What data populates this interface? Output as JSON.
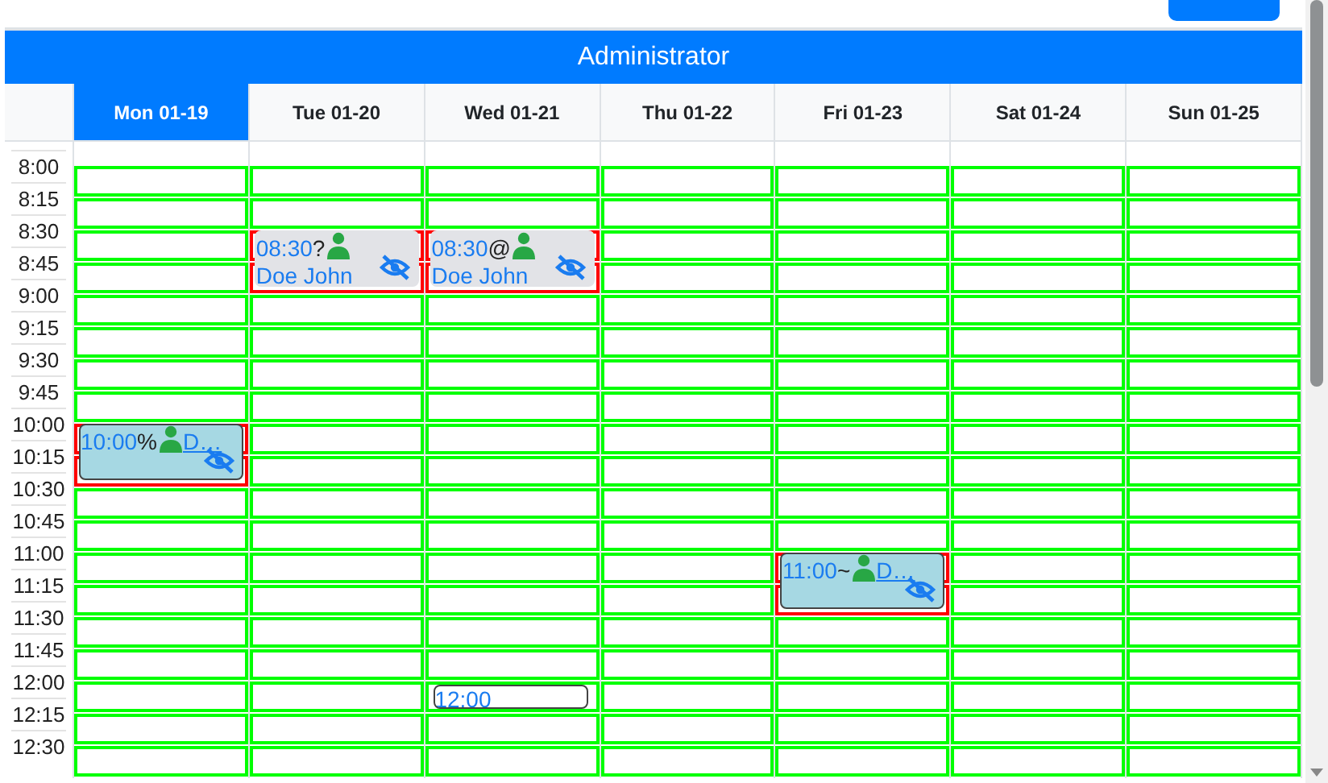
{
  "title": "Administrator",
  "days": [
    {
      "label": "Mon 01-19",
      "selected": true
    },
    {
      "label": "Tue 01-20",
      "selected": false
    },
    {
      "label": "Wed 01-21",
      "selected": false
    },
    {
      "label": "Thu 01-22",
      "selected": false
    },
    {
      "label": "Fri 01-23",
      "selected": false
    },
    {
      "label": "Sat 01-24",
      "selected": false
    },
    {
      "label": "Sun 01-25",
      "selected": false
    }
  ],
  "rows": [
    {
      "time": "8:00",
      "cells": [
        {
          "highlighted": false
        },
        {
          "highlighted": false
        },
        {
          "highlighted": false
        },
        {
          "highlighted": false
        },
        {
          "highlighted": false
        },
        {
          "highlighted": false
        },
        {
          "highlighted": false
        }
      ]
    },
    {
      "time": "8:15",
      "cells": [
        {
          "highlighted": false
        },
        {
          "highlighted": false
        },
        {
          "highlighted": false
        },
        {
          "highlighted": false
        },
        {
          "highlighted": false
        },
        {
          "highlighted": false
        },
        {
          "highlighted": false
        }
      ]
    },
    {
      "time": "8:30",
      "cells": [
        {
          "highlighted": false
        },
        {
          "highlighted": true,
          "event": {
            "kind": "booking",
            "tall": true,
            "color": "#e2e3e7",
            "time": "08:30",
            "symbol": "?",
            "name": "Doe John"
          }
        },
        {
          "highlighted": true,
          "event": {
            "kind": "booking",
            "tall": true,
            "color": "#e2e3e7",
            "time": "08:30",
            "symbol": "@",
            "name": "Doe John"
          }
        },
        {
          "highlighted": false
        },
        {
          "highlighted": false
        },
        {
          "highlighted": false
        },
        {
          "highlighted": false
        }
      ]
    },
    {
      "time": "8:45",
      "cells": [
        {
          "highlighted": false
        },
        {
          "highlighted": true
        },
        {
          "highlighted": true
        },
        {
          "highlighted": false
        },
        {
          "highlighted": false
        },
        {
          "highlighted": false
        },
        {
          "highlighted": false
        }
      ]
    },
    {
      "time": "9:00",
      "cells": [
        {
          "highlighted": false
        },
        {
          "highlighted": false
        },
        {
          "highlighted": false
        },
        {
          "highlighted": false
        },
        {
          "highlighted": false
        },
        {
          "highlighted": false
        },
        {
          "highlighted": false
        }
      ]
    },
    {
      "time": "9:15",
      "cells": [
        {
          "highlighted": false
        },
        {
          "highlighted": false
        },
        {
          "highlighted": false
        },
        {
          "highlighted": false
        },
        {
          "highlighted": false
        },
        {
          "highlighted": false
        },
        {
          "highlighted": false
        }
      ]
    },
    {
      "time": "9:30",
      "cells": [
        {
          "highlighted": false
        },
        {
          "highlighted": false
        },
        {
          "highlighted": false
        },
        {
          "highlighted": false
        },
        {
          "highlighted": false
        },
        {
          "highlighted": false
        },
        {
          "highlighted": false
        }
      ]
    },
    {
      "time": "9:45",
      "cells": [
        {
          "highlighted": false
        },
        {
          "highlighted": false
        },
        {
          "highlighted": false
        },
        {
          "highlighted": false
        },
        {
          "highlighted": false
        },
        {
          "highlighted": false
        },
        {
          "highlighted": false
        }
      ]
    },
    {
      "time": "10:00",
      "cells": [
        {
          "highlighted": true,
          "event": {
            "kind": "booking",
            "tall": true,
            "color": "#a6d8e3",
            "time": "10:00",
            "symbol": "%",
            "name": "D…"
          }
        },
        {
          "highlighted": false
        },
        {
          "highlighted": false
        },
        {
          "highlighted": false
        },
        {
          "highlighted": false
        },
        {
          "highlighted": false
        },
        {
          "highlighted": false
        }
      ]
    },
    {
      "time": "10:15",
      "cells": [
        {
          "highlighted": true
        },
        {
          "highlighted": false
        },
        {
          "highlighted": false
        },
        {
          "highlighted": false
        },
        {
          "highlighted": false
        },
        {
          "highlighted": false
        },
        {
          "highlighted": false
        }
      ]
    },
    {
      "time": "10:30",
      "cells": [
        {
          "highlighted": false
        },
        {
          "highlighted": false
        },
        {
          "highlighted": false
        },
        {
          "highlighted": false
        },
        {
          "highlighted": false
        },
        {
          "highlighted": false
        },
        {
          "highlighted": false
        }
      ]
    },
    {
      "time": "10:45",
      "cells": [
        {
          "highlighted": false
        },
        {
          "highlighted": false
        },
        {
          "highlighted": false
        },
        {
          "highlighted": false
        },
        {
          "highlighted": false
        },
        {
          "highlighted": false
        },
        {
          "highlighted": false
        }
      ]
    },
    {
      "time": "11:00",
      "cells": [
        {
          "highlighted": false
        },
        {
          "highlighted": false
        },
        {
          "highlighted": false
        },
        {
          "highlighted": false
        },
        {
          "highlighted": true,
          "event": {
            "kind": "booking",
            "tall": true,
            "color": "#a6d8e3",
            "time": "11:00",
            "symbol": "~",
            "name": "D…"
          }
        },
        {
          "highlighted": false
        },
        {
          "highlighted": false
        }
      ]
    },
    {
      "time": "11:15",
      "cells": [
        {
          "highlighted": false
        },
        {
          "highlighted": false
        },
        {
          "highlighted": false
        },
        {
          "highlighted": false
        },
        {
          "highlighted": true
        },
        {
          "highlighted": false
        },
        {
          "highlighted": false
        }
      ]
    },
    {
      "time": "11:30",
      "cells": [
        {
          "highlighted": false
        },
        {
          "highlighted": false
        },
        {
          "highlighted": false
        },
        {
          "highlighted": false
        },
        {
          "highlighted": false
        },
        {
          "highlighted": false
        },
        {
          "highlighted": false
        }
      ]
    },
    {
      "time": "11:45",
      "cells": [
        {
          "highlighted": false
        },
        {
          "highlighted": false
        },
        {
          "highlighted": false
        },
        {
          "highlighted": false
        },
        {
          "highlighted": false
        },
        {
          "highlighted": false
        },
        {
          "highlighted": false
        }
      ]
    },
    {
      "time": "12:00",
      "cells": [
        {
          "highlighted": false
        },
        {
          "highlighted": false
        },
        {
          "highlighted": false,
          "event": {
            "kind": "slot",
            "tall": false,
            "color": "#ffffff",
            "time": "12:00"
          }
        },
        {
          "highlighted": false
        },
        {
          "highlighted": false
        },
        {
          "highlighted": false
        },
        {
          "highlighted": false
        }
      ]
    },
    {
      "time": "12:15",
      "cells": [
        {
          "highlighted": false
        },
        {
          "highlighted": false
        },
        {
          "highlighted": false
        },
        {
          "highlighted": false
        },
        {
          "highlighted": false
        },
        {
          "highlighted": false
        },
        {
          "highlighted": false
        }
      ]
    },
    {
      "time": "12:30",
      "cells": [
        {
          "highlighted": false
        },
        {
          "highlighted": false
        },
        {
          "highlighted": false
        },
        {
          "highlighted": false
        },
        {
          "highlighted": false
        },
        {
          "highlighted": false
        },
        {
          "highlighted": false
        }
      ]
    }
  ]
}
